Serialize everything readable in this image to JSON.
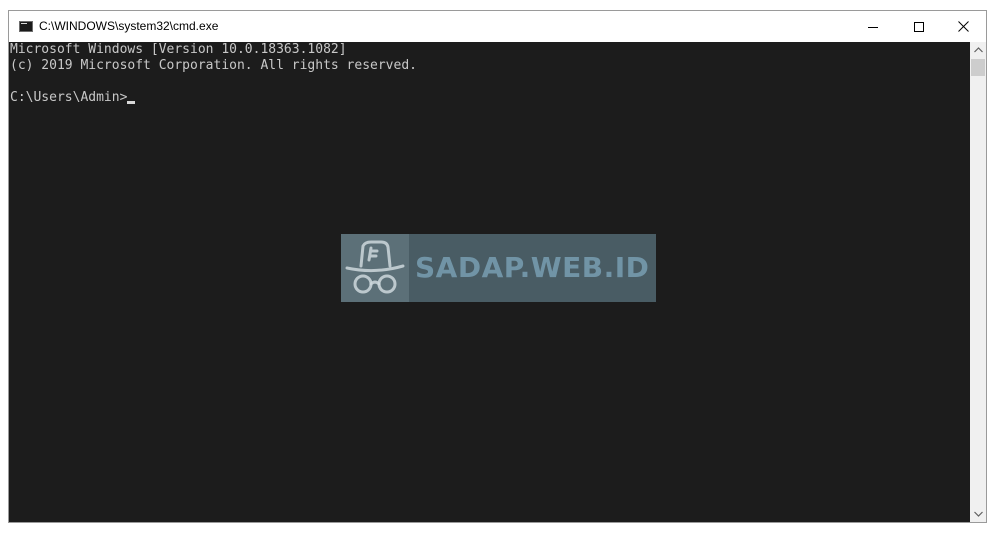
{
  "window": {
    "title": "C:\\WINDOWS\\system32\\cmd.exe",
    "app_icon": "cmd-icon",
    "buttons": {
      "minimize_icon": "minimize-icon",
      "maximize_icon": "maximize-icon",
      "close_icon": "close-icon"
    }
  },
  "terminal": {
    "lines": [
      "Microsoft Windows [Version 10.0.18363.1082]",
      "(c) 2019 Microsoft Corporation. All rights reserved.",
      "C:\\Users\\Admin>"
    ],
    "background_color": "#1c1c1c",
    "text_color": "#c8c8c8"
  },
  "watermark": {
    "text": "SADAP.WEB.ID",
    "logo_icon": "hat-glasses-icon"
  },
  "scrollbar": {
    "up_icon": "chevron-up-icon",
    "down_icon": "chevron-down-icon"
  }
}
